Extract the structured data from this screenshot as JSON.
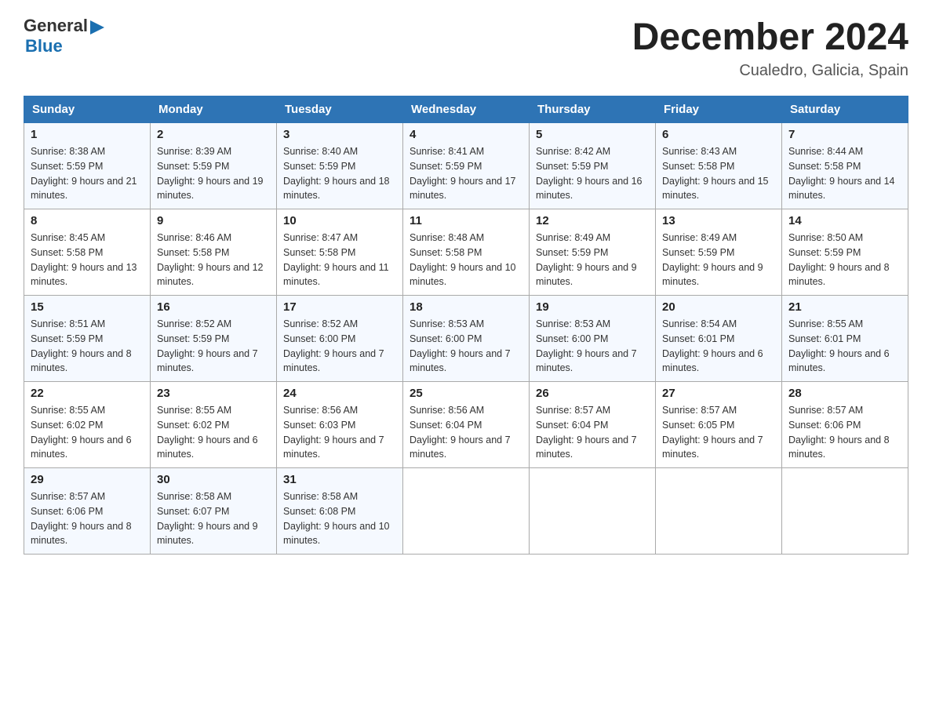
{
  "header": {
    "logo_general": "General",
    "logo_blue": "Blue",
    "month_year": "December 2024",
    "location": "Cualedro, Galicia, Spain"
  },
  "weekdays": [
    "Sunday",
    "Monday",
    "Tuesday",
    "Wednesday",
    "Thursday",
    "Friday",
    "Saturday"
  ],
  "weeks": [
    [
      {
        "day": "1",
        "sunrise": "8:38 AM",
        "sunset": "5:59 PM",
        "daylight": "9 hours and 21 minutes."
      },
      {
        "day": "2",
        "sunrise": "8:39 AM",
        "sunset": "5:59 PM",
        "daylight": "9 hours and 19 minutes."
      },
      {
        "day": "3",
        "sunrise": "8:40 AM",
        "sunset": "5:59 PM",
        "daylight": "9 hours and 18 minutes."
      },
      {
        "day": "4",
        "sunrise": "8:41 AM",
        "sunset": "5:59 PM",
        "daylight": "9 hours and 17 minutes."
      },
      {
        "day": "5",
        "sunrise": "8:42 AM",
        "sunset": "5:59 PM",
        "daylight": "9 hours and 16 minutes."
      },
      {
        "day": "6",
        "sunrise": "8:43 AM",
        "sunset": "5:58 PM",
        "daylight": "9 hours and 15 minutes."
      },
      {
        "day": "7",
        "sunrise": "8:44 AM",
        "sunset": "5:58 PM",
        "daylight": "9 hours and 14 minutes."
      }
    ],
    [
      {
        "day": "8",
        "sunrise": "8:45 AM",
        "sunset": "5:58 PM",
        "daylight": "9 hours and 13 minutes."
      },
      {
        "day": "9",
        "sunrise": "8:46 AM",
        "sunset": "5:58 PM",
        "daylight": "9 hours and 12 minutes."
      },
      {
        "day": "10",
        "sunrise": "8:47 AM",
        "sunset": "5:58 PM",
        "daylight": "9 hours and 11 minutes."
      },
      {
        "day": "11",
        "sunrise": "8:48 AM",
        "sunset": "5:58 PM",
        "daylight": "9 hours and 10 minutes."
      },
      {
        "day": "12",
        "sunrise": "8:49 AM",
        "sunset": "5:59 PM",
        "daylight": "9 hours and 9 minutes."
      },
      {
        "day": "13",
        "sunrise": "8:49 AM",
        "sunset": "5:59 PM",
        "daylight": "9 hours and 9 minutes."
      },
      {
        "day": "14",
        "sunrise": "8:50 AM",
        "sunset": "5:59 PM",
        "daylight": "9 hours and 8 minutes."
      }
    ],
    [
      {
        "day": "15",
        "sunrise": "8:51 AM",
        "sunset": "5:59 PM",
        "daylight": "9 hours and 8 minutes."
      },
      {
        "day": "16",
        "sunrise": "8:52 AM",
        "sunset": "5:59 PM",
        "daylight": "9 hours and 7 minutes."
      },
      {
        "day": "17",
        "sunrise": "8:52 AM",
        "sunset": "6:00 PM",
        "daylight": "9 hours and 7 minutes."
      },
      {
        "day": "18",
        "sunrise": "8:53 AM",
        "sunset": "6:00 PM",
        "daylight": "9 hours and 7 minutes."
      },
      {
        "day": "19",
        "sunrise": "8:53 AM",
        "sunset": "6:00 PM",
        "daylight": "9 hours and 7 minutes."
      },
      {
        "day": "20",
        "sunrise": "8:54 AM",
        "sunset": "6:01 PM",
        "daylight": "9 hours and 6 minutes."
      },
      {
        "day": "21",
        "sunrise": "8:55 AM",
        "sunset": "6:01 PM",
        "daylight": "9 hours and 6 minutes."
      }
    ],
    [
      {
        "day": "22",
        "sunrise": "8:55 AM",
        "sunset": "6:02 PM",
        "daylight": "9 hours and 6 minutes."
      },
      {
        "day": "23",
        "sunrise": "8:55 AM",
        "sunset": "6:02 PM",
        "daylight": "9 hours and 6 minutes."
      },
      {
        "day": "24",
        "sunrise": "8:56 AM",
        "sunset": "6:03 PM",
        "daylight": "9 hours and 7 minutes."
      },
      {
        "day": "25",
        "sunrise": "8:56 AM",
        "sunset": "6:04 PM",
        "daylight": "9 hours and 7 minutes."
      },
      {
        "day": "26",
        "sunrise": "8:57 AM",
        "sunset": "6:04 PM",
        "daylight": "9 hours and 7 minutes."
      },
      {
        "day": "27",
        "sunrise": "8:57 AM",
        "sunset": "6:05 PM",
        "daylight": "9 hours and 7 minutes."
      },
      {
        "day": "28",
        "sunrise": "8:57 AM",
        "sunset": "6:06 PM",
        "daylight": "9 hours and 8 minutes."
      }
    ],
    [
      {
        "day": "29",
        "sunrise": "8:57 AM",
        "sunset": "6:06 PM",
        "daylight": "9 hours and 8 minutes."
      },
      {
        "day": "30",
        "sunrise": "8:58 AM",
        "sunset": "6:07 PM",
        "daylight": "9 hours and 9 minutes."
      },
      {
        "day": "31",
        "sunrise": "8:58 AM",
        "sunset": "6:08 PM",
        "daylight": "9 hours and 10 minutes."
      },
      null,
      null,
      null,
      null
    ]
  ]
}
